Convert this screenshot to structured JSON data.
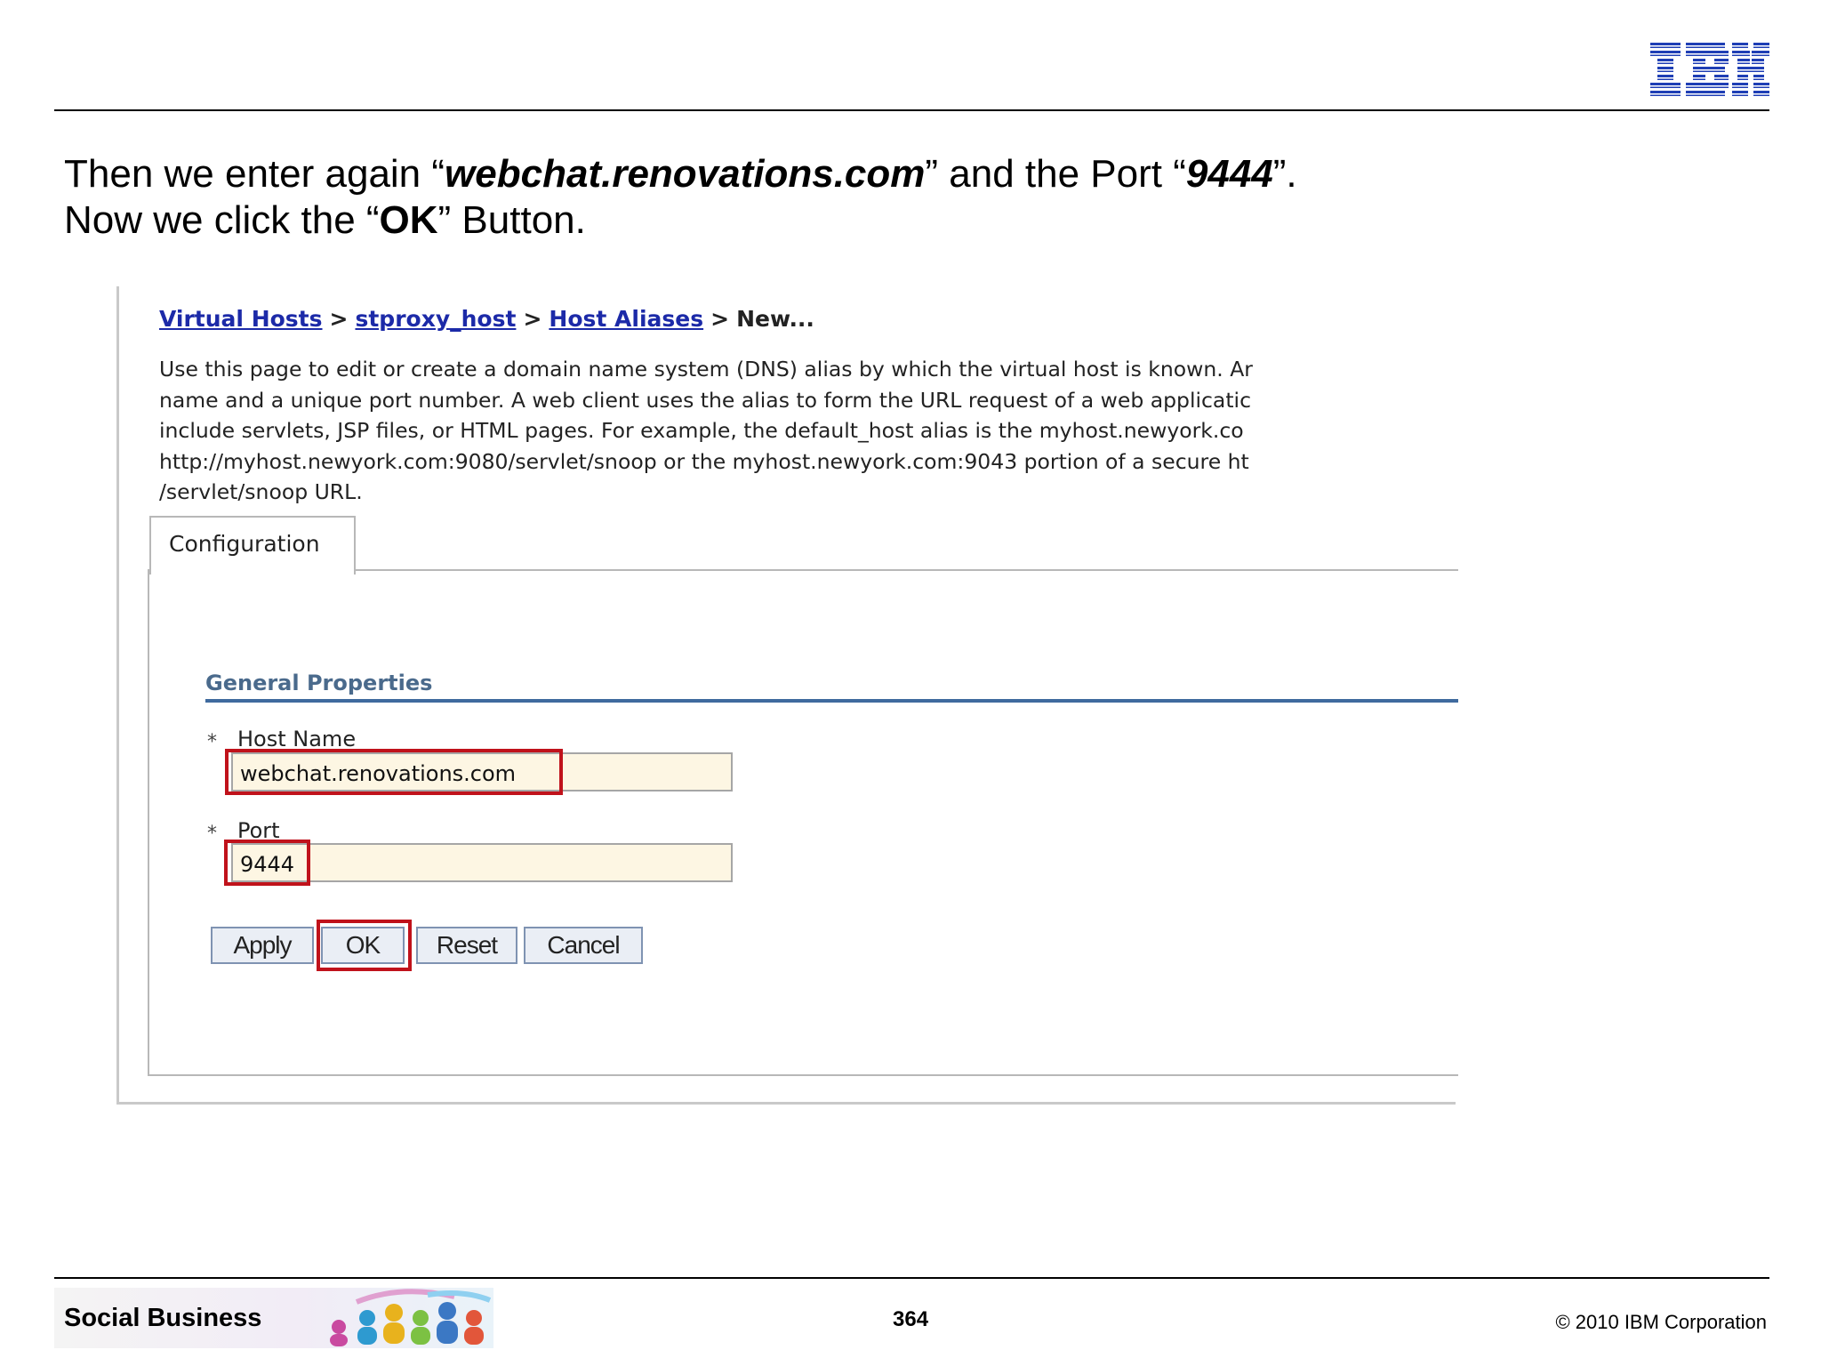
{
  "logo": {
    "text": "IBM",
    "color": "#1f3fb5"
  },
  "instructions": {
    "line1_prefix": "Then we enter again “",
    "line1_host": "webchat.renovations.com",
    "line1_middle": "” and the Port “",
    "line1_port": "9444",
    "line1_suffix": "”.",
    "line2_prefix": "Now we click the “",
    "line2_button": "OK",
    "line2_suffix": "” Button."
  },
  "screenshot": {
    "breadcrumb": {
      "items": [
        "Virtual Hosts",
        "stproxy_host",
        "Host Aliases"
      ],
      "separator": ">",
      "current": "New..."
    },
    "description_lines": [
      "Use this page to edit or create a domain name system (DNS) alias by which the virtual host is known. Ar",
      "name and a unique port number. A web client uses the alias to form the URL request of a web applicatic",
      "include servlets, JSP files, or HTML pages. For example, the default_host alias is the myhost.newyork.co",
      "http://myhost.newyork.com:9080/servlet/snoop or the myhost.newyork.com:9043 portion of a secure ht",
      "/servlet/snoop URL."
    ],
    "tab_label": "Configuration",
    "section_title": "General Properties",
    "required_marker": "*",
    "host_name": {
      "label": "Host Name",
      "value": "webchat.renovations.com"
    },
    "port": {
      "label": "Port",
      "value": "9444"
    },
    "buttons": {
      "apply": "Apply",
      "ok": "OK",
      "reset": "Reset",
      "cancel": "Cancel"
    },
    "highlight_color": "#c0121b",
    "link_color": "#1c2aa8"
  },
  "footer": {
    "brand": "Social Business",
    "page_number": "364",
    "copyright": "© 2010 IBM Corporation"
  }
}
